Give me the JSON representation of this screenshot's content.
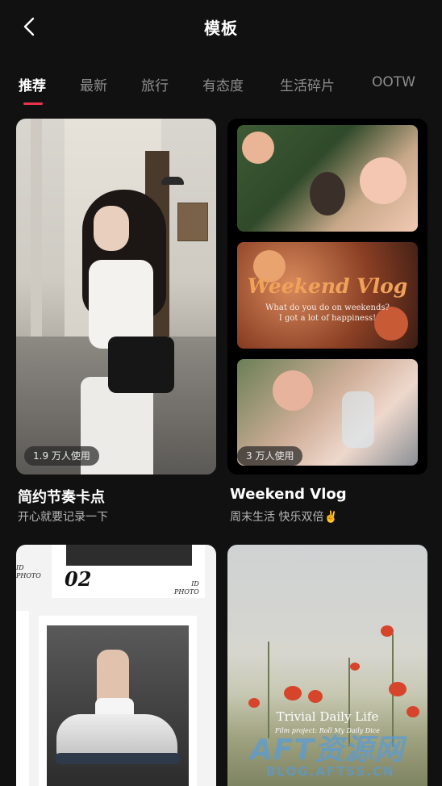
{
  "header": {
    "title": "模板",
    "back_icon": "chevron-left-icon"
  },
  "tabs": [
    {
      "label": "推荐",
      "active": true
    },
    {
      "label": "最新",
      "active": false
    },
    {
      "label": "旅行",
      "active": false
    },
    {
      "label": "有态度",
      "active": false
    },
    {
      "label": "生活碎片",
      "active": false
    },
    {
      "label": "OOTW",
      "active": false
    }
  ],
  "accent_color": "#e8344a",
  "templates": [
    {
      "badge": "1.9 万人使用",
      "title": "简约节奏卡点",
      "subtitle": "开心就要记录一下"
    },
    {
      "badge": "3 万人使用",
      "title": "Weekend Vlog",
      "subtitle": "周末生活 快乐双倍✌️",
      "overlay_title": "Weekend Vlog",
      "overlay_line1": "What do you do on weekends?",
      "overlay_line2": "I got a lot of happiness!"
    },
    {
      "overlay_number": "02",
      "overlay_id": "ID",
      "overlay_photo": "PHOTO"
    },
    {
      "overlay_title": "Trivial Daily Life",
      "overlay_sub": "Film project: Roll My Daily Dice"
    }
  ],
  "watermark": {
    "line1": "AFT资源网",
    "line2": "BLOG.AFTSS.CN"
  }
}
